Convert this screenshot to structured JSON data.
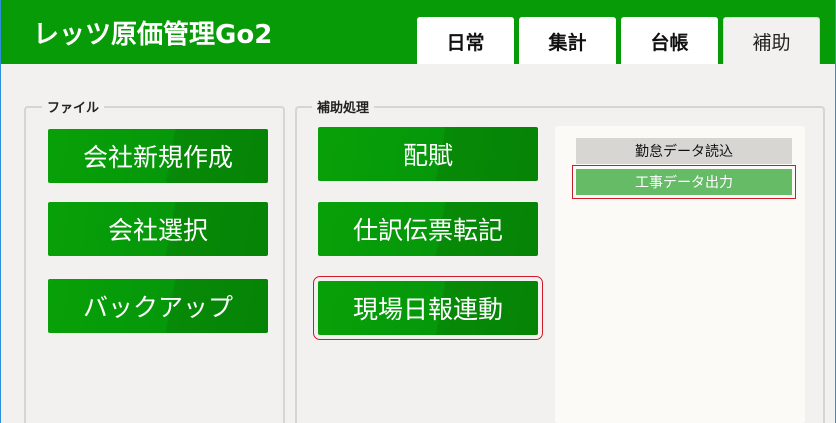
{
  "app": {
    "title": "レッツ原価管理Go2"
  },
  "tabs": [
    {
      "label": "日常"
    },
    {
      "label": "集計"
    },
    {
      "label": "台帳"
    },
    {
      "label": "補助"
    }
  ],
  "file_group": {
    "label": "ファイル",
    "buttons": [
      {
        "label": "会社新規作成"
      },
      {
        "label": "会社選択"
      },
      {
        "label": "バックアップ"
      }
    ]
  },
  "aux_group": {
    "label": "補助処理",
    "buttons": [
      {
        "label": "配賦"
      },
      {
        "label": "仕訳伝票転記"
      },
      {
        "label": "現場日報連動"
      }
    ],
    "list_items": [
      {
        "label": "勤怠データ読込"
      },
      {
        "label": "工事データ出力"
      }
    ]
  },
  "colors": {
    "header_green": "#089b08",
    "button_green": "#08a008",
    "selected_item": "#66bb66",
    "highlight_border": "#d11a2a"
  }
}
